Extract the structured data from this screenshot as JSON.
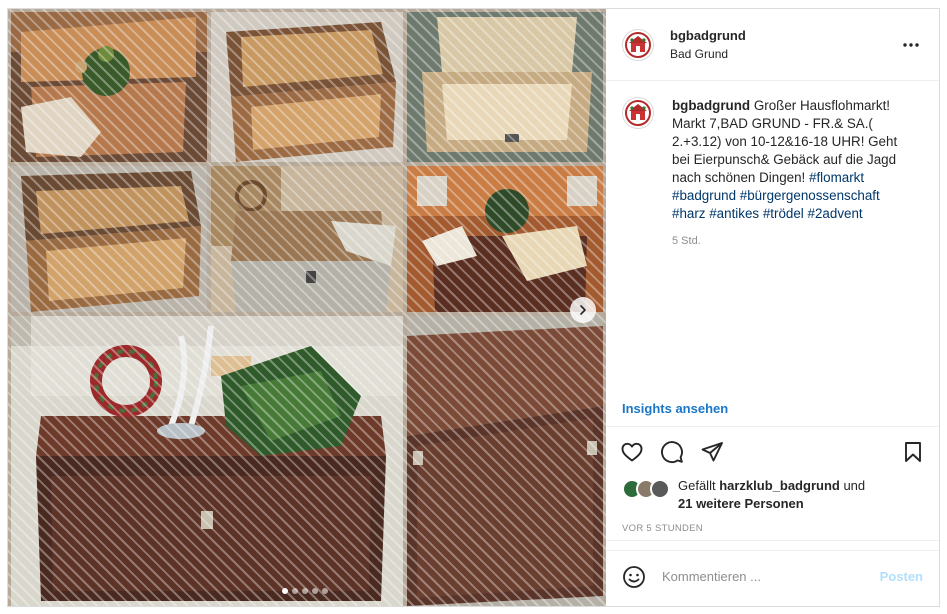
{
  "header": {
    "username": "bgbadgrund",
    "location": "Bad Grund"
  },
  "caption": {
    "username": "bgbadgrund",
    "text": "Großer Hausflohmarkt! Markt 7,BAD GRUND - FR.& SA.( 2.+3.12) von 10-12&16-18 UHR! Geht bei Eierpunsch& Gebäck auf die Jagd nach schönen Dingen!",
    "hashtags": [
      "#flomarkt",
      "#badgrund",
      "#bürgergenossenschaft",
      "#harz",
      "#antikes",
      "#trödel",
      "#2advent"
    ],
    "age": "5 Std."
  },
  "insights_label": "Insights ansehen",
  "likes": {
    "prefix": "Gefällt",
    "liker": "harzklub_badgrund",
    "connector": "und",
    "others": "21 weitere Personen"
  },
  "timestamp": "VOR 5 STUNDEN",
  "comment": {
    "placeholder": "Kommentieren ...",
    "post_label": "Posten"
  },
  "carousel": {
    "slides": 5,
    "active": 1
  },
  "icons": {
    "more": "more-horizontal-icon",
    "like": "heart-icon",
    "comment": "comment-icon",
    "share": "paper-plane-icon",
    "save": "bookmark-icon",
    "emoji": "emoji-icon",
    "next": "chevron-right-icon"
  },
  "colors": {
    "link_blue": "#1a77c9",
    "hashtag": "#00376b",
    "muted": "#8e8e8e",
    "post_disabled": "#b2dffc"
  }
}
